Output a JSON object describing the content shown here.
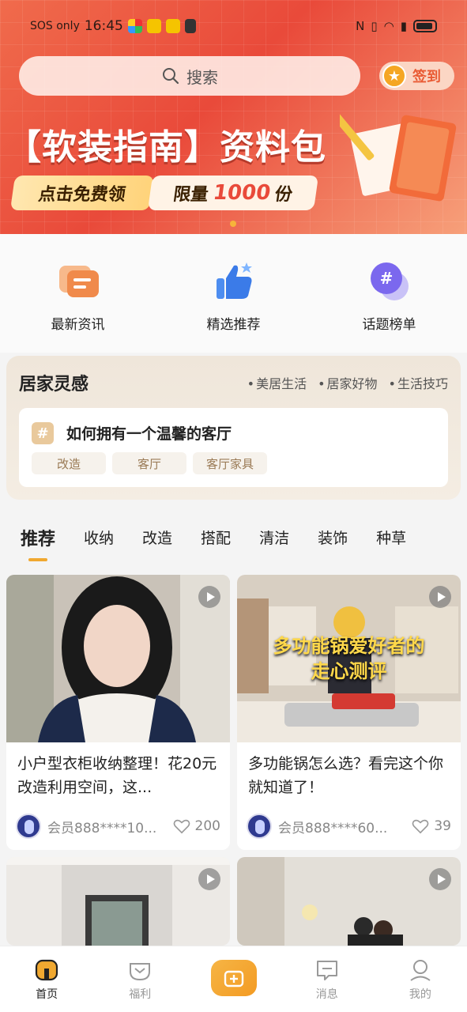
{
  "status_bar": {
    "carrier": "SOS only",
    "time": "16:45"
  },
  "search": {
    "placeholder": "搜索"
  },
  "signin": {
    "label": "签到"
  },
  "banner": {
    "title": "【软装指南】资料包",
    "button_free": "点击免费领",
    "limit_prefix": "限量",
    "limit_number": "1000",
    "limit_suffix": "份"
  },
  "quick_entries": [
    {
      "label": "最新资讯",
      "icon": "news-icon"
    },
    {
      "label": "精选推荐",
      "icon": "thumbs-up-icon"
    },
    {
      "label": "话题榜单",
      "icon": "topic-hash-icon"
    }
  ],
  "inspiration": {
    "title": "居家灵感",
    "tags": [
      "美居生活",
      "居家好物",
      "生活技巧"
    ],
    "topic": {
      "title": "如何拥有一个温馨的客厅",
      "chips": [
        "改造",
        "客厅",
        "客厅家具"
      ]
    }
  },
  "tabs": [
    "推荐",
    "收纳",
    "改造",
    "搭配",
    "清洁",
    "装饰",
    "种草"
  ],
  "feed": [
    {
      "title": "小户型衣柜收纳整理！花20元改造利用空间，这...",
      "author": "会员888****10...",
      "likes": "200"
    },
    {
      "title": "多功能锅怎么选？看完这个你就知道了！",
      "author": "会员888****60...",
      "likes": "39",
      "overlay_line1": "多功能锅爱好者的",
      "overlay_line2": "走心测评"
    },
    {
      "title": "",
      "author": "",
      "likes": ""
    },
    {
      "title": "",
      "author": "",
      "likes": ""
    }
  ],
  "bottom_nav": [
    {
      "label": "首页",
      "icon": "home-icon"
    },
    {
      "label": "福利",
      "icon": "gift-icon"
    },
    {
      "label": "",
      "icon": "publish-icon"
    },
    {
      "label": "消息",
      "icon": "message-icon"
    },
    {
      "label": "我的",
      "icon": "profile-icon"
    }
  ],
  "colors": {
    "accent": "#F0A830",
    "banner": "#E94A3A",
    "chip_text": "#9A7A55"
  }
}
